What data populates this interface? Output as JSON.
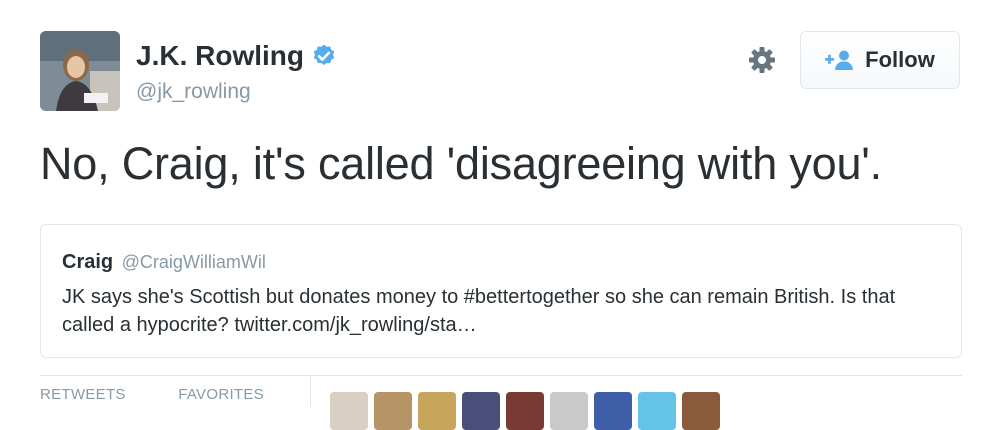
{
  "user": {
    "name": "J.K. Rowling",
    "handle": "@jk_rowling",
    "verified": true
  },
  "actions": {
    "follow_label": "Follow",
    "settings_icon": "gear-icon",
    "follow_icon": "add-user-icon"
  },
  "tweet": {
    "text": "No, Craig, it's called 'disagreeing with you'."
  },
  "quoted": {
    "name": "Craig",
    "handle": "@CraigWilliamWil",
    "text": "JK says she's Scottish but donates money to #bettertogether so she can remain British. Is that called a hypocrite? twitter.com/jk_rowling/sta…"
  },
  "stats": {
    "retweets_label": "RETWEETS",
    "favorites_label": "FAVORITES"
  },
  "colors": {
    "verified_blue": "#55acee",
    "text": "#292f33",
    "muted": "#8899a6",
    "border": "#e1e8ed",
    "follow_icon": "#55acee"
  },
  "favoriter_avatars": [
    {
      "color": "#d9cfc2"
    },
    {
      "color": "#b79466"
    },
    {
      "color": "#c7a55a"
    },
    {
      "color": "#4a4f7a"
    },
    {
      "color": "#7a3a34"
    },
    {
      "color": "#c9c9c9"
    },
    {
      "color": "#3f5ea8"
    },
    {
      "color": "#66c3e8"
    },
    {
      "color": "#8a5a3a"
    }
  ]
}
